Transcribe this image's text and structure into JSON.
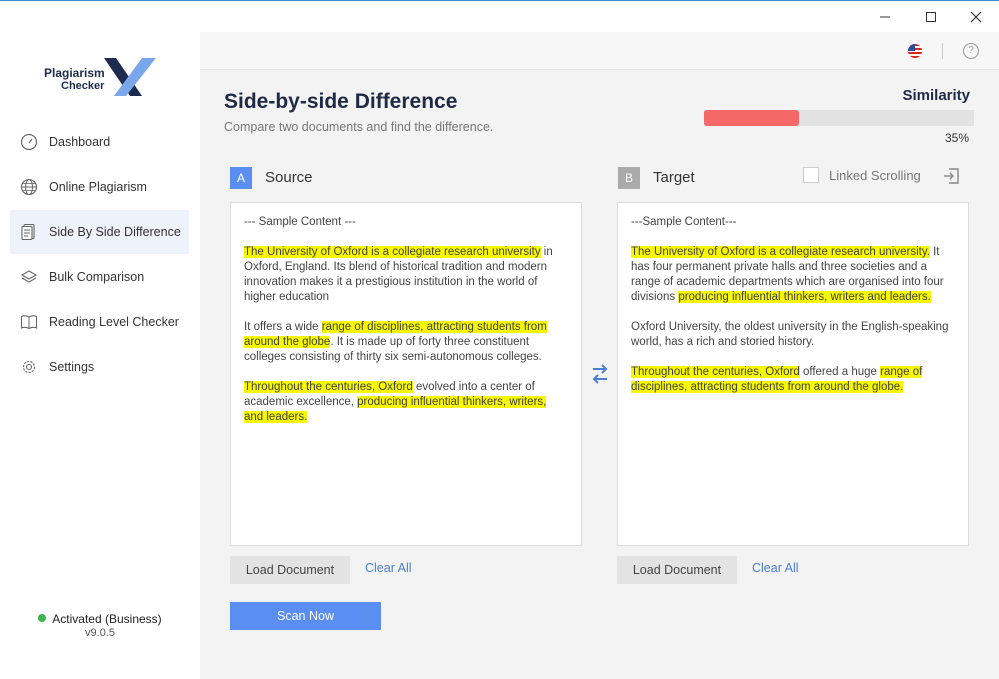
{
  "window": {
    "minimize_icon": "minimize-icon",
    "maximize_icon": "maximize-icon",
    "close_icon": "close-icon"
  },
  "logo": {
    "line1": "Plagiarism",
    "line2": "Checker"
  },
  "sidebar": {
    "items": [
      {
        "label": "Dashboard",
        "icon": "gauge-icon",
        "active": false
      },
      {
        "label": "Online Plagiarism",
        "icon": "globe-icon",
        "active": false
      },
      {
        "label": "Side By Side Difference",
        "icon": "document-icon",
        "active": true
      },
      {
        "label": "Bulk Comparison",
        "icon": "layers-icon",
        "active": false
      },
      {
        "label": "Reading Level Checker",
        "icon": "book-icon",
        "active": false
      },
      {
        "label": "Settings",
        "icon": "gear-icon",
        "active": false
      }
    ],
    "activation": "Activated (Business)",
    "version": "v9.0.5"
  },
  "header": {
    "title": "Side-by-side Difference",
    "subtitle": "Compare two documents and find the difference."
  },
  "similarity": {
    "label": "Similarity",
    "value": 0.35,
    "text": "35%",
    "color": "#f56868"
  },
  "source": {
    "badge": "A",
    "label": "Source",
    "badge_color": "#5a8ef0",
    "paragraphs": [
      [
        {
          "t": "--- Sample Content ---",
          "h": false
        }
      ],
      [
        {
          "t": "The University of Oxford is a collegiate research university",
          "h": true
        },
        {
          "t": " in Oxford, England. Its blend of historical tradition and modern innovation makes it a prestigious institution in the world of higher education",
          "h": false
        }
      ],
      [
        {
          "t": "It offers a wide ",
          "h": false
        },
        {
          "t": "range of disciplines, attracting students from around the globe",
          "h": true
        },
        {
          "t": ". It is made up of forty three constituent colleges consisting of thirty six semi-autonomous colleges.",
          "h": false
        }
      ],
      [
        {
          "t": "Throughout the centuries, Oxford",
          "h": true
        },
        {
          "t": " evolved into a center of academic excellence, ",
          "h": false
        },
        {
          "t": "producing influential thinkers, writers, and leaders.",
          "h": true
        }
      ]
    ],
    "load_label": "Load Document",
    "clear_label": "Clear All"
  },
  "target": {
    "badge": "B",
    "label": "Target",
    "badge_color": "#aaaaaa",
    "linked_scrolling": "Linked Scrolling",
    "paragraphs": [
      [
        {
          "t": "---Sample Content---",
          "h": false
        }
      ],
      [
        {
          "t": "The University of Oxford is a collegiate research university.",
          "h": true
        },
        {
          "t": " It has four permanent private halls and three societies and a range of academic departments which are organised into four divisions ",
          "h": false
        },
        {
          "t": "producing influential thinkers, writers and leaders.",
          "h": true
        }
      ],
      [
        {
          "t": "Oxford University, the oldest university in the English-speaking world, has a rich and storied history.",
          "h": false
        }
      ],
      [
        {
          "t": "Throughout the centuries, Oxford",
          "h": true
        },
        {
          "t": " offered a huge ",
          "h": false
        },
        {
          "t": "range of disciplines, attracting students from around the globe.",
          "h": true
        }
      ]
    ],
    "load_label": "Load Document",
    "clear_label": "Clear All"
  },
  "scan_label": "Scan Now",
  "highlight_color": "#f7f700"
}
